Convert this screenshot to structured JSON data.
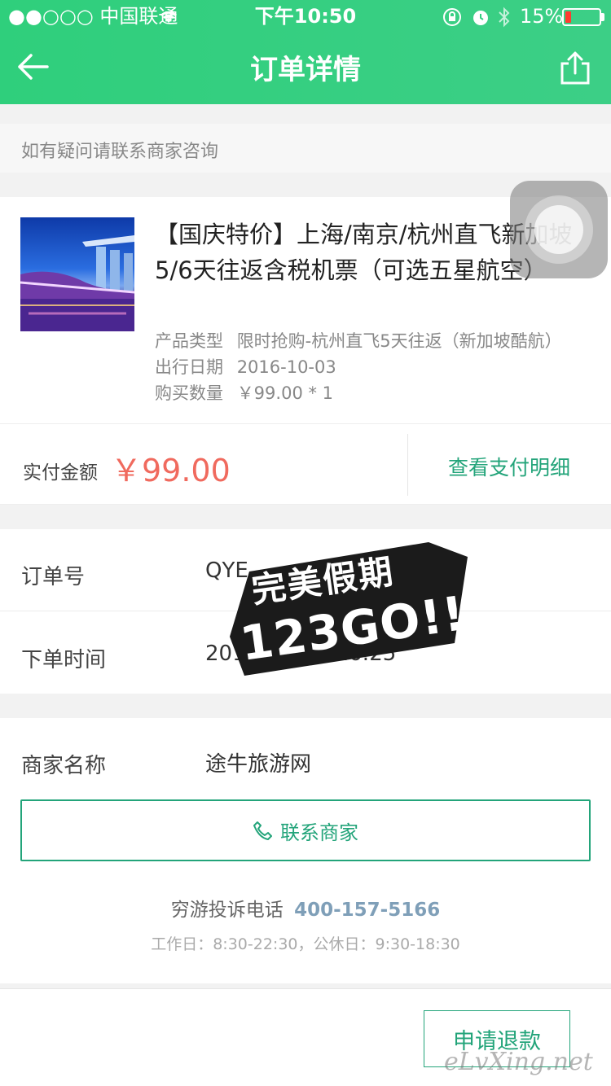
{
  "status_bar": {
    "carrier": "●●○○○ 中国联通",
    "time": "下午10:50",
    "battery": "15%"
  },
  "nav": {
    "title": "订单详情"
  },
  "notice": "如有疑问请联系商家咨询",
  "product": {
    "title": "【国庆特价】上海/南京/杭州直飞新加坡5/6天往返含税机票（可选五星航空）",
    "type_label": "产品类型",
    "type_value": "限时抢购-杭州直飞5天往返（新加坡酷航）",
    "date_label": "出行日期",
    "date_value": "2016-10-03",
    "qty_label": "购买数量",
    "qty_value": "￥99.00 * 1"
  },
  "payment": {
    "label": "实付金额",
    "amount": "￥99.00",
    "detail_link": "查看支付明细"
  },
  "order": {
    "number_label": "订单号",
    "number_value": "QYE",
    "time_label": "下单时间",
    "time_value": "2016-09-27 16:25"
  },
  "merchant": {
    "name_label": "商家名称",
    "name_value": "途牛旅游网",
    "contact_button": "联系商家",
    "complaint_label": "穷游投诉电话",
    "complaint_phone": "400-157-5166",
    "hours": "工作日：8:30-22:30，公休日：9:30-18:30"
  },
  "actions": {
    "refund_button": "申请退款"
  },
  "watermark": {
    "stamp_line1": "完美假期",
    "stamp_line2": "123GO!!",
    "corner": "eLvXing.net"
  },
  "colors": {
    "accent": "#23a47a",
    "price": "#f06a5e",
    "nav_bg": "#33cf80"
  }
}
